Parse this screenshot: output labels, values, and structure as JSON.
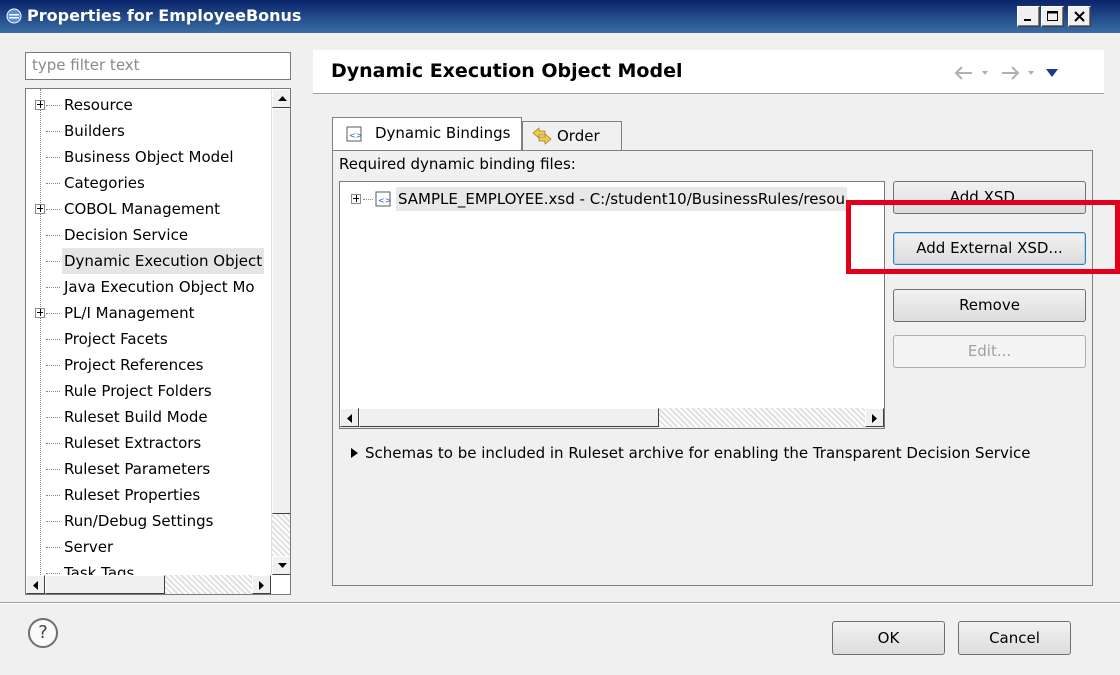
{
  "window": {
    "title": "Properties for EmployeeBonus",
    "minimize": "_",
    "maximize": "□",
    "close": "X"
  },
  "filter": {
    "placeholder": "type filter text"
  },
  "tree": {
    "items": [
      {
        "label": "Resource",
        "expandable": true
      },
      {
        "label": "Builders",
        "expandable": false
      },
      {
        "label": "Business Object Model",
        "expandable": false
      },
      {
        "label": "Categories",
        "expandable": false
      },
      {
        "label": "COBOL Management",
        "expandable": true
      },
      {
        "label": "Decision Service",
        "expandable": false
      },
      {
        "label": "Dynamic Execution Object",
        "expandable": false,
        "selected": true
      },
      {
        "label": "Java Execution Object Mo",
        "expandable": false
      },
      {
        "label": "PL/I Management",
        "expandable": true
      },
      {
        "label": "Project Facets",
        "expandable": false
      },
      {
        "label": "Project References",
        "expandable": false
      },
      {
        "label": "Rule Project Folders",
        "expandable": false
      },
      {
        "label": "Ruleset Build Mode",
        "expandable": false
      },
      {
        "label": "Ruleset Extractors",
        "expandable": false
      },
      {
        "label": "Ruleset Parameters",
        "expandable": false
      },
      {
        "label": "Ruleset Properties",
        "expandable": false
      },
      {
        "label": "Run/Debug Settings",
        "expandable": false
      },
      {
        "label": "Server",
        "expandable": false
      },
      {
        "label": "Task Tags",
        "expandable": false
      }
    ]
  },
  "page": {
    "title": "Dynamic Execution Object Model"
  },
  "tabs": [
    {
      "label": "Dynamic Bindings",
      "active": true
    },
    {
      "label": "Order",
      "active": false
    }
  ],
  "panel": {
    "required_label": "Required dynamic binding files:",
    "file_entry": "SAMPLE_EMPLOYEE.xsd - C:/student10/BusinessRules/resou",
    "buttons": {
      "add_xsd": "Add XSD...",
      "add_external_xsd": "Add External XSD...",
      "remove": "Remove",
      "edit": "Edit..."
    },
    "schemas_label": "Schemas to be included in Ruleset archive for enabling the Transparent Decision Service"
  },
  "footer": {
    "help": "?",
    "ok": "OK",
    "cancel": "Cancel"
  },
  "colors": {
    "titlebar": "#0a246a",
    "highlight_box": "#e1001b",
    "selected_row": "#e5e5e5"
  }
}
